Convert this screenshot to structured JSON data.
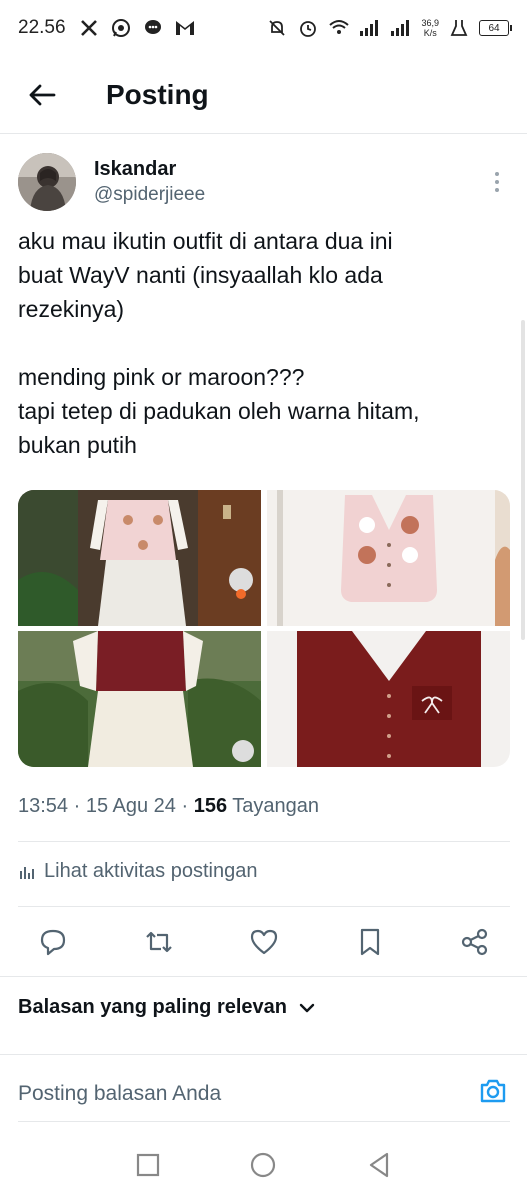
{
  "status_bar": {
    "time": "22.56",
    "left_icons": [
      "x-icon",
      "whatsapp-icon",
      "chat-icon",
      "gmail-icon"
    ],
    "speed_top": "36,9",
    "speed_bottom": "K/s",
    "battery": "64"
  },
  "header": {
    "title": "Posting"
  },
  "author": {
    "name": "Iskandar",
    "handle": "@spiderjieee"
  },
  "tweet": {
    "lines_a": [
      "aku mau ikutin outfit di antara dua ini",
      "buat WayV nanti (insyaallah klo ada",
      "rezekinya)"
    ],
    "lines_b": [
      "mending pink or maroon???",
      "tapi tetep di padukan oleh warna hitam,",
      "bukan putih"
    ]
  },
  "meta": {
    "time": "13:54",
    "sep1": " · ",
    "date": "15 Agu 24",
    "sep2": " · ",
    "views": "156",
    "views_label": " Tayangan"
  },
  "activity": {
    "label": "Lihat aktivitas postingan"
  },
  "replies_sort": {
    "label": "Balasan yang paling relevan"
  },
  "reply_box": {
    "placeholder": "Posting balasan Anda"
  },
  "colors": {
    "accent": "#1d9bf0",
    "text": "#0f1419",
    "muted": "#536471",
    "pink": "#f1d7d7",
    "maroon": "#7a1c1c"
  }
}
